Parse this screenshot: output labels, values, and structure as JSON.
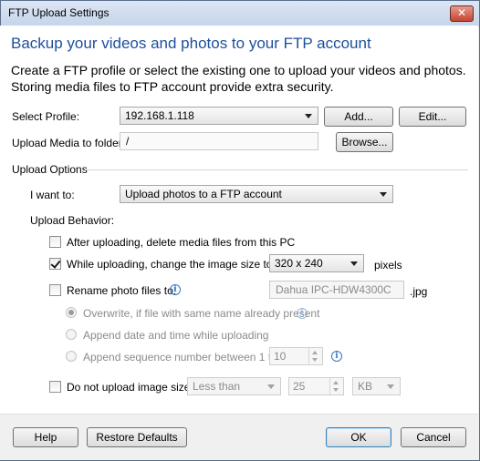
{
  "window": {
    "title": "FTP Upload Settings",
    "close_glyph": "✕"
  },
  "heading": "Backup your videos and photos to your FTP account",
  "intro": "Create a FTP profile or select the existing one to upload your videos and photos. Storing media files to FTP account provide extra security.",
  "profile": {
    "label": "Select Profile:",
    "value": "192.168.1.118",
    "add_label": "Add...",
    "edit_label": "Edit..."
  },
  "folder": {
    "label": "Upload Media to folder:",
    "value": "/",
    "browse_label": "Browse..."
  },
  "upload_options": {
    "label": "Upload Options",
    "want_label": "I want to:",
    "want_value": "Upload photos to a FTP account",
    "behavior_label": "Upload Behavior:",
    "delete_after": {
      "label": "After uploading, delete media files from this PC",
      "checked": false
    },
    "change_size": {
      "label": "While uploading, change the image size to:",
      "checked": true,
      "value": "320 x 240",
      "unit": "pixels"
    },
    "rename": {
      "label": "Rename photo files to:",
      "checked": false,
      "value": "Dahua IPC-HDW4300C",
      "ext": ".jpg"
    },
    "radio_overwrite": {
      "label": "Overwrite, if file with same name already present",
      "selected": true
    },
    "radio_append_date": {
      "label": "Append date and time while uploading",
      "selected": false
    },
    "radio_append_seq": {
      "label": "Append sequence number between 1 to:",
      "selected": false,
      "value": "10"
    },
    "no_upload_size": {
      "label": "Do not upload image size:",
      "checked": false,
      "comparator": "Less than",
      "value": "25",
      "unit": "KB"
    }
  },
  "footer": {
    "help_label": "Help",
    "restore_label": "Restore Defaults",
    "ok_label": "OK",
    "cancel_label": "Cancel"
  },
  "colors": {
    "heading": "#1e4f9c",
    "info_icon": "#3478c5"
  }
}
